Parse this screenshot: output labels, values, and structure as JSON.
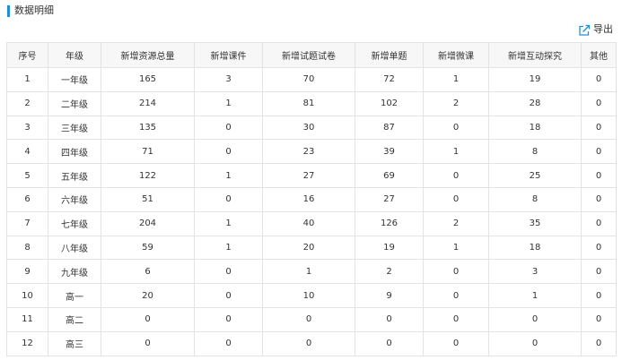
{
  "section": {
    "title": "数据明细"
  },
  "toolbar": {
    "export_label": "导出",
    "export_icon": "export-icon",
    "accent_color": "#1e8fe0"
  },
  "table": {
    "headers": [
      "序号",
      "年级",
      "新增资源总量",
      "新增课件",
      "新增试题试卷",
      "新增单题",
      "新增微课",
      "新增互动探究",
      "其他"
    ],
    "rows": [
      [
        "1",
        "一年级",
        "165",
        "3",
        "70",
        "72",
        "1",
        "19",
        "0"
      ],
      [
        "2",
        "二年级",
        "214",
        "1",
        "81",
        "102",
        "2",
        "28",
        "0"
      ],
      [
        "3",
        "三年级",
        "135",
        "0",
        "30",
        "87",
        "0",
        "18",
        "0"
      ],
      [
        "4",
        "四年级",
        "71",
        "0",
        "23",
        "39",
        "1",
        "8",
        "0"
      ],
      [
        "5",
        "五年级",
        "122",
        "1",
        "27",
        "69",
        "0",
        "25",
        "0"
      ],
      [
        "6",
        "六年级",
        "51",
        "0",
        "16",
        "27",
        "0",
        "8",
        "0"
      ],
      [
        "7",
        "七年级",
        "204",
        "1",
        "40",
        "126",
        "2",
        "35",
        "0"
      ],
      [
        "8",
        "八年级",
        "59",
        "1",
        "20",
        "19",
        "1",
        "18",
        "0"
      ],
      [
        "9",
        "九年级",
        "6",
        "0",
        "1",
        "2",
        "0",
        "3",
        "0"
      ],
      [
        "10",
        "高一",
        "20",
        "0",
        "10",
        "9",
        "0",
        "1",
        "0"
      ],
      [
        "11",
        "高二",
        "0",
        "0",
        "0",
        "0",
        "0",
        "0",
        "0"
      ],
      [
        "12",
        "高三",
        "0",
        "0",
        "0",
        "0",
        "0",
        "0",
        "0"
      ]
    ]
  }
}
